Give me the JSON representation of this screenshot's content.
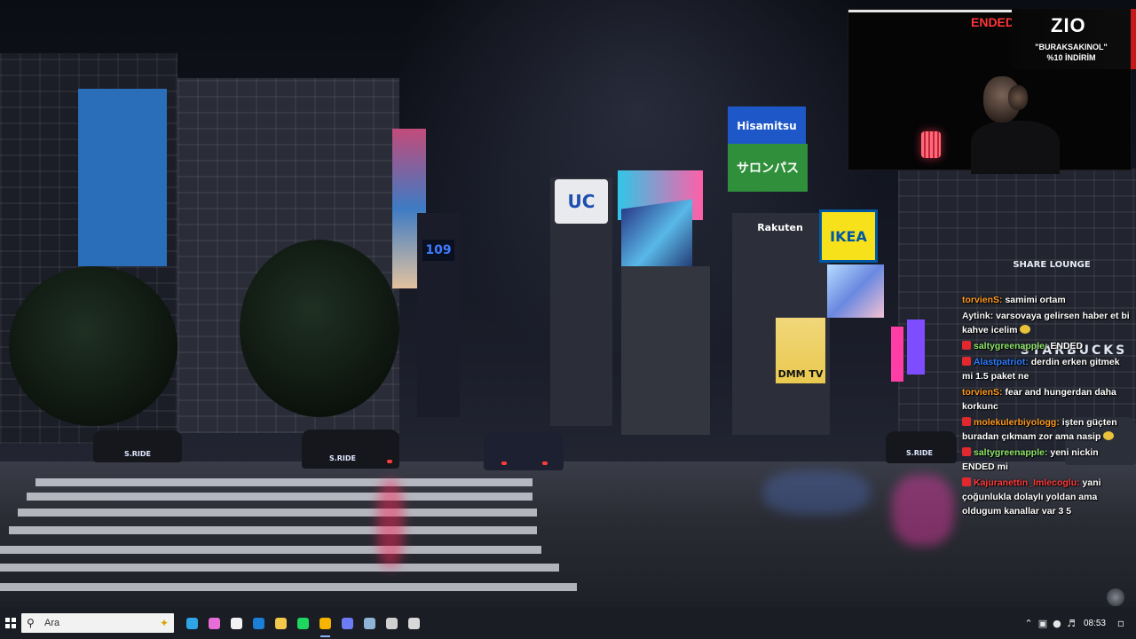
{
  "scene": {
    "signs": {
      "uc": "UC",
      "hisamitsu": "Hisamitsu",
      "salonpas": "サロンパス",
      "rakuten": "Rakuten",
      "ikea": "IKEA",
      "dmm": "DMM TV",
      "shibuya109": "109",
      "lounge": "SHARE LOUNGE",
      "starbucks": "STARBUCKS",
      "sride_left": "S.RIDE",
      "sride_mid": "S.RIDE",
      "sride_right": "S.RIDE"
    }
  },
  "webcam": {
    "status": "ENDED",
    "brand": {
      "logo": "ZIO",
      "line1": "\"BURAKSAKINOL\"",
      "line2": "%10 İNDİRİM"
    }
  },
  "chat": {
    "messages": [
      {
        "user": "torvienS:",
        "user_color": "#ff9a1f",
        "text": "samimi ortam",
        "badge": false,
        "emote": false
      },
      {
        "user": "Aytink:",
        "user_color": "#f0f0f0",
        "text": "varsovaya gelirsen haber et bi kahve icelim",
        "badge": false,
        "emote": true
      },
      {
        "user": "saltygreenapple:",
        "user_color": "#8ee66a",
        "text": "ENDED",
        "badge": true,
        "emote": false
      },
      {
        "user": "Alastpatriot:",
        "user_color": "#2d7bff",
        "text": "derdin erken gitmek mi 1.5 paket ne",
        "badge": true,
        "emote": false
      },
      {
        "user": "torvienS:",
        "user_color": "#ff9a1f",
        "text": "fear and hungerdan daha korkunc",
        "badge": false,
        "emote": false
      },
      {
        "user": "molekulerbiyologg:",
        "user_color": "#ff9a1f",
        "text": "işten güçten buradan çıkmam zor ama nasip",
        "badge": true,
        "emote": true
      },
      {
        "user": "saltygreenapple:",
        "user_color": "#8ee66a",
        "text": "yeni nickin ENDED mi",
        "badge": true,
        "emote": false
      },
      {
        "user": "Kajuranettin_Imlecoglu:",
        "user_color": "#ff3b3b",
        "text": "yani çoğunlukla dolaylı yoldan ama oldugum kanallar var 3 5",
        "badge": true,
        "emote": false
      }
    ]
  },
  "taskbar": {
    "search_placeholder": "Ara",
    "apps": [
      {
        "name": "edge",
        "color": "#2fa5e6"
      },
      {
        "name": "copilot",
        "color": "#e86dd8"
      },
      {
        "name": "store",
        "color": "#f3f3f3"
      },
      {
        "name": "outlook",
        "color": "#1a7fd6"
      },
      {
        "name": "file-explorer",
        "color": "#f2c94c"
      },
      {
        "name": "spotify",
        "color": "#1ed760"
      },
      {
        "name": "chrome",
        "color": "#f4b400"
      },
      {
        "name": "discord",
        "color": "#6d7cf5"
      },
      {
        "name": "steam",
        "color": "#8fb4d6"
      },
      {
        "name": "audio-app",
        "color": "#d0d0d0"
      },
      {
        "name": "obs",
        "color": "#d8d8d8"
      }
    ],
    "clock": "08:53"
  }
}
